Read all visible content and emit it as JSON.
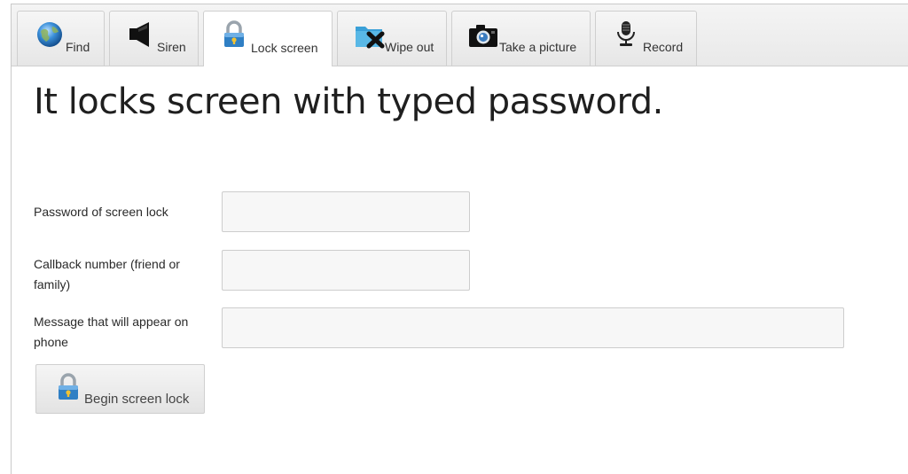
{
  "tabs": [
    {
      "label": "Find",
      "icon": "globe-icon",
      "active": false
    },
    {
      "label": "Siren",
      "icon": "speaker-icon",
      "active": false
    },
    {
      "label": "Lock screen",
      "icon": "padlock-icon",
      "active": true
    },
    {
      "label": "Wipe out",
      "icon": "folder-delete-icon",
      "active": false
    },
    {
      "label": "Take a picture",
      "icon": "camera-icon",
      "active": false
    },
    {
      "label": "Record",
      "icon": "microphone-icon",
      "active": false
    }
  ],
  "main": {
    "headline": "It locks screen with typed password.",
    "fields": [
      {
        "label": "Password of screen lock",
        "value": "",
        "placeholder": ""
      },
      {
        "label": "Callback number (friend or family)",
        "value": "",
        "placeholder": ""
      },
      {
        "label": "Message that will appear on phone",
        "value": "",
        "placeholder": ""
      }
    ],
    "submit_label": "Begin screen lock",
    "submit_icon": "padlock-icon"
  },
  "colors": {
    "lock_blue": "#2f7fc4",
    "lock_gold": "#f1c232",
    "folder_blue": "#3aa0d8"
  }
}
